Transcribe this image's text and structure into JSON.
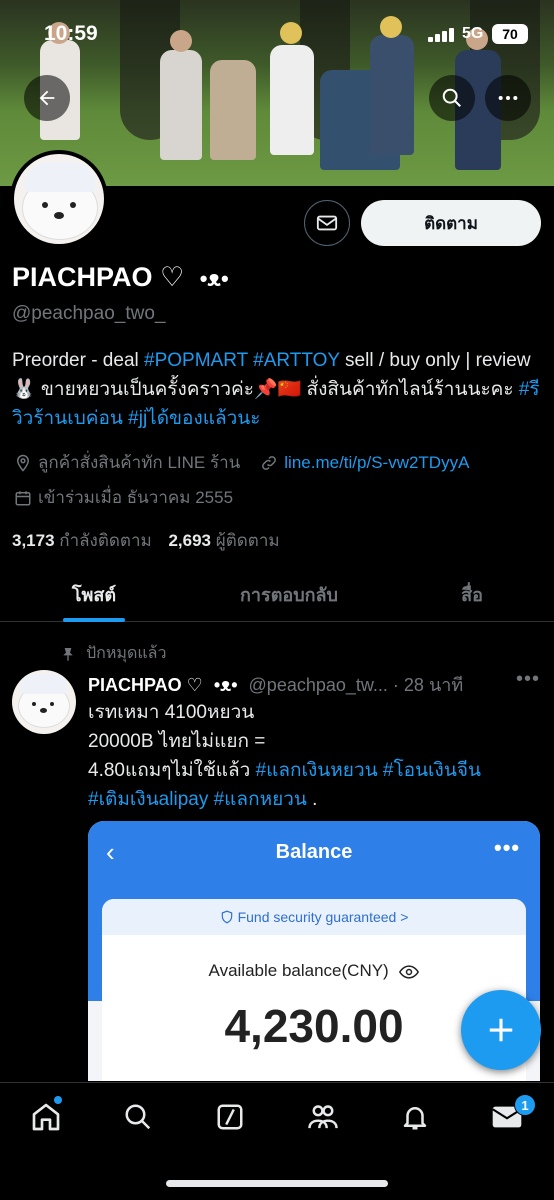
{
  "status_bar": {
    "time": "10:59",
    "network": "5G",
    "battery": "70"
  },
  "profile": {
    "name": "PIACHPAO ♡",
    "name_suffix": "•ᴥ•",
    "handle": "@peachpao_two_",
    "follow_label": "ติดตาม",
    "bio_line1_a": "Preorder - deal ",
    "bio_tag1": "#POPMART",
    "bio_sp": " ",
    "bio_tag2": "#ARTTOY",
    "bio_line1_b": " sell / buy only | review 🐰 ขายหยวนเป็นครั้งคราวค่ะ📌🇨🇳 สั่งสินค้าทักไลน์ร้านนะคะ ",
    "bio_tag3": "#รีวิวร้านเบค่อน",
    "bio_sp2": " ",
    "bio_tag4": "#jjได้ของแล้วนะ",
    "location": "ลูกค้าสั่งสินค้าทัก LINE ร้าน",
    "website": "line.me/ti/p/S-vw2TDyyA",
    "joined": "เข้าร่วมเมื่อ ธันวาคม 2555",
    "following_count": "3,173",
    "following_label": "กำลังติดตาม",
    "followers_count": "2,693",
    "followers_label": "ผู้ติดตาม"
  },
  "tabs": [
    {
      "label": "โพสต์",
      "active": true
    },
    {
      "label": "การตอบกลับ",
      "active": false
    },
    {
      "label": "สื่อ",
      "active": false
    }
  ],
  "post": {
    "pinned_label": "ปักหมุดแล้ว",
    "author": "PIACHPAO ♡",
    "author_suffix": "•ᴥ•",
    "handle": "@peachpao_tw...",
    "time": "· 28 นาที",
    "text_plain": "เรทเหมา 4100หยวน\n 20000B ไทยไม่แยก =\n4.80แถมๆไม่ใช้แล้ว ",
    "tag1": "#แลกเงินหยวน",
    "tag2": "#โอนเงินจีน",
    "tag3": "#เติมเงินalipay",
    "tag4": "#แลกหยวน",
    "text_end": " .",
    "embed": {
      "title": "Balance",
      "security": "Fund security guaranteed >",
      "label": "Available balance(CNY)",
      "amount": "4,230.00"
    }
  },
  "bottom_nav": {
    "messages_badge": "1"
  },
  "colors": {
    "accent": "#1d9bf0",
    "background": "#000000",
    "muted": "#71767b"
  }
}
